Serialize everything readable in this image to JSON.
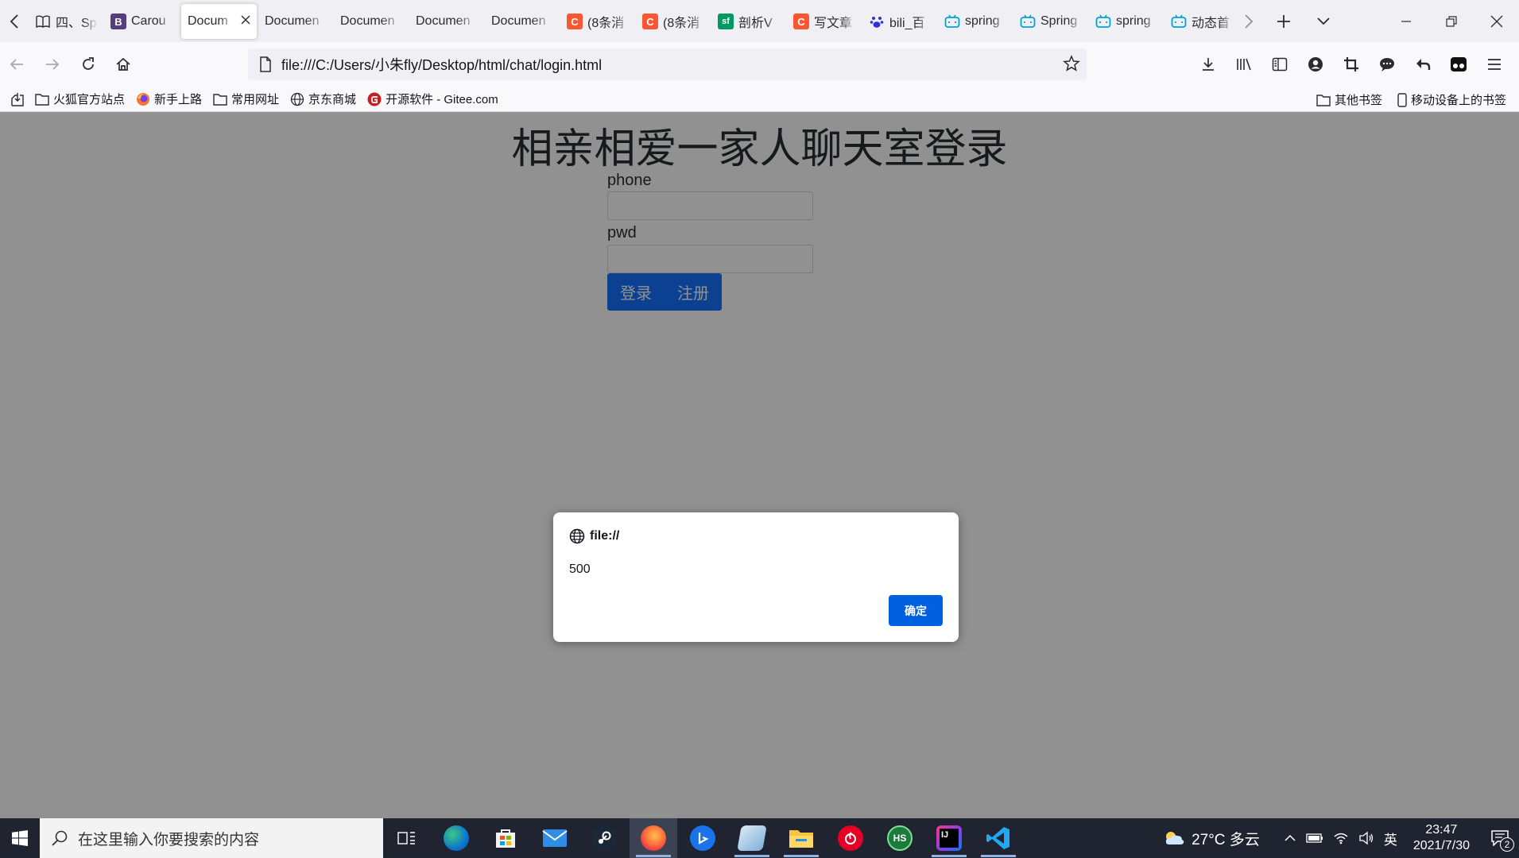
{
  "tabs": [
    {
      "title": "四、Sp",
      "icon": "book-icon",
      "color": "#2b2a33",
      "glyph": ""
    },
    {
      "title": "Carou",
      "icon": "bootstrap-icon",
      "color": "#563d7c",
      "glyph": "B"
    },
    {
      "title": "Docum",
      "icon": "",
      "color": "",
      "glyph": "",
      "active": true
    },
    {
      "title": "Documen",
      "icon": "",
      "color": "",
      "glyph": ""
    },
    {
      "title": "Documen",
      "icon": "",
      "color": "",
      "glyph": ""
    },
    {
      "title": "Documen",
      "icon": "",
      "color": "",
      "glyph": ""
    },
    {
      "title": "Documen",
      "icon": "",
      "color": "",
      "glyph": ""
    },
    {
      "title": "(8条消",
      "icon": "csdn-icon",
      "color": "#fc5531",
      "glyph": "C"
    },
    {
      "title": "(8条消",
      "icon": "csdn-icon",
      "color": "#fc5531",
      "glyph": "C"
    },
    {
      "title": "剖析V",
      "icon": "segmentfault-icon",
      "color": "#009a61",
      "glyph": "sf"
    },
    {
      "title": "写文章",
      "icon": "csdn-icon",
      "color": "#fc5531",
      "glyph": "C"
    },
    {
      "title": "bili_百",
      "icon": "baidu-paw-icon",
      "color": "#2932e1",
      "glyph": "🐾"
    },
    {
      "title": "spring",
      "icon": "bilibili-icon",
      "color": "#00a1d6",
      "glyph": "📺"
    },
    {
      "title": "Spring",
      "icon": "bilibili-icon",
      "color": "#00a1d6",
      "glyph": "📺"
    },
    {
      "title": "spring",
      "icon": "bilibili-icon",
      "color": "#00a1d6",
      "glyph": "📺"
    },
    {
      "title": "动态首",
      "icon": "bilibili-icon",
      "color": "#00a1d6",
      "glyph": "📺"
    }
  ],
  "address": {
    "url": "file:///C:/Users/小朱fly/Desktop/html/chat/login.html"
  },
  "bookmarks": {
    "left": [
      {
        "label": "火狐官方站点",
        "icon": "folder-icon"
      },
      {
        "label": "新手上路",
        "icon": "firefox-icon"
      },
      {
        "label": "常用网址",
        "icon": "folder-icon"
      },
      {
        "label": "京东商城",
        "icon": "globe-icon"
      },
      {
        "label": "开源软件 - Gitee.com",
        "icon": "gitee-icon"
      }
    ],
    "other": "其他书签",
    "mobile": "移动设备上的书签"
  },
  "page": {
    "heading": "相亲相爱一家人聊天室登录",
    "phone_label": "phone",
    "pwd_label": "pwd",
    "login_button": "登录",
    "register_button": "注册"
  },
  "dialog": {
    "origin": "file://",
    "message": "500",
    "ok_button": "确定"
  },
  "taskbar": {
    "search_placeholder": "在这里输入你要搜索的内容",
    "weather": "27°C 多云",
    "ime": "英",
    "time": "23:47",
    "date": "2021/7/30",
    "notification_count": "2"
  },
  "colors": {
    "primary": "#0d6efd",
    "dialog_button": "#0061e0",
    "taskbar": "#1f2430"
  }
}
